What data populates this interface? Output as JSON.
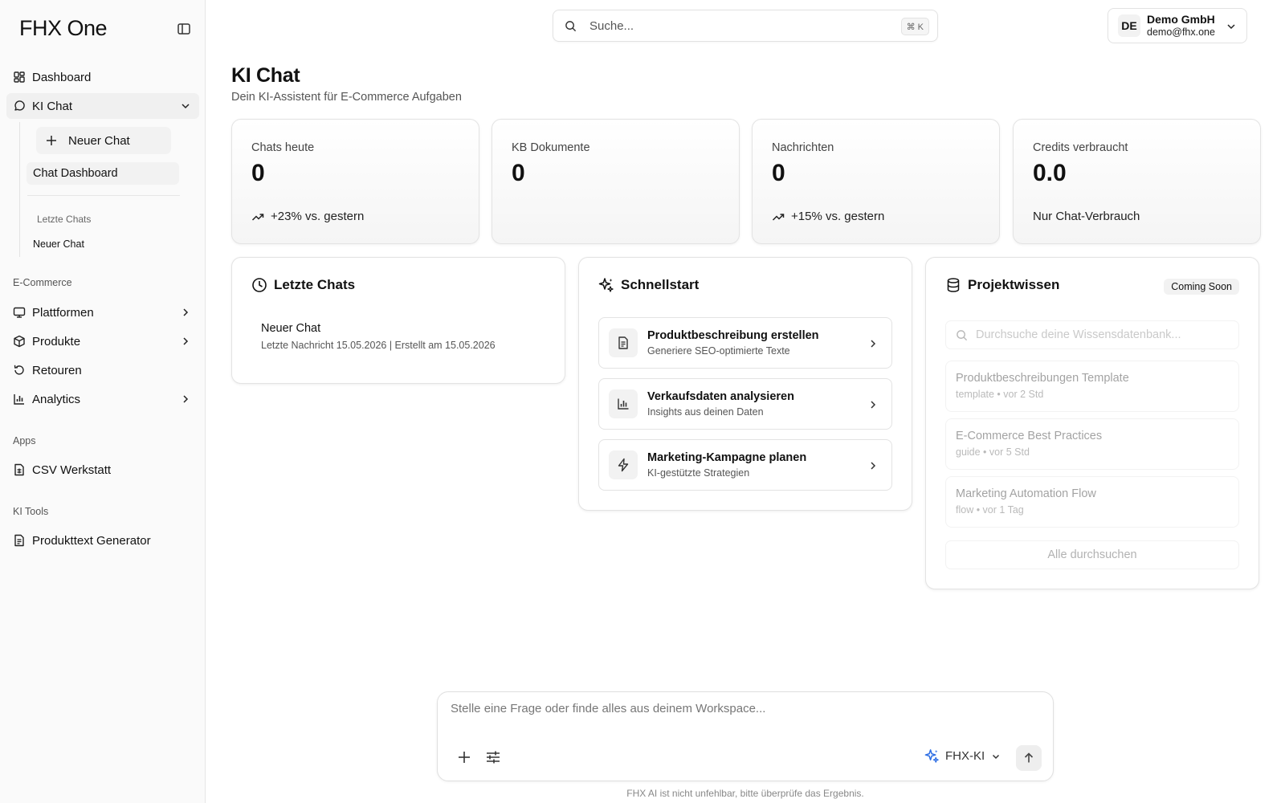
{
  "sidebar": {
    "brand": "FHX One",
    "nav_top": [
      {
        "label": "Dashboard"
      },
      {
        "label": "KI Chat"
      }
    ],
    "ki_chat": {
      "new_chat": "Neuer Chat",
      "chat_dashboard": "Chat Dashboard",
      "recent_caption": "Letzte Chats",
      "recent": [
        "Neuer Chat"
      ]
    },
    "ecommerce": {
      "label": "E-Commerce",
      "items": [
        {
          "label": "Plattformen"
        },
        {
          "label": "Produkte"
        },
        {
          "label": "Retouren"
        },
        {
          "label": "Analytics"
        }
      ]
    },
    "apps": {
      "label": "Apps",
      "items": [
        {
          "label": "CSV Werkstatt"
        }
      ]
    },
    "ki_tools": {
      "label": "KI Tools",
      "items": [
        {
          "label": "Produkttext Generator"
        }
      ]
    }
  },
  "topbar": {
    "search_placeholder": "Suche...",
    "shortcut": "⌘ K",
    "account": {
      "initials": "DE",
      "name": "Demo GmbH",
      "email": "demo@fhx.one"
    }
  },
  "header": {
    "title": "KI Chat",
    "subtitle": "Dein KI-Assistent für E-Commerce Aufgaben"
  },
  "stats": [
    {
      "label": "Chats heute",
      "value": "0",
      "footer": "+23% vs. gestern"
    },
    {
      "label": "KB Dokumente",
      "value": "0",
      "footer": ""
    },
    {
      "label": "Nachrichten",
      "value": "0",
      "footer": "+15% vs. gestern"
    },
    {
      "label": "Credits verbraucht",
      "value": "0.0",
      "footer": "Nur Chat-Verbrauch"
    }
  ],
  "recent_chats": {
    "title": "Letzte Chats",
    "items": [
      {
        "title": "Neuer Chat",
        "meta": "Letzte Nachricht 15.05.2026 | Erstellt am 15.05.2026"
      }
    ]
  },
  "quickstart": {
    "title": "Schnellstart",
    "items": [
      {
        "title": "Produktbeschreibung erstellen",
        "subtitle": "Generiere SEO-optimierte Texte",
        "icon": "document-icon"
      },
      {
        "title": "Verkaufsdaten analysieren",
        "subtitle": "Insights aus deinen Daten",
        "icon": "bar-chart-icon"
      },
      {
        "title": "Marketing-Kampagne planen",
        "subtitle": "KI-gestützte Strategien",
        "icon": "lightning-icon"
      }
    ]
  },
  "project_knowledge": {
    "title": "Projektwissen",
    "badge": "Coming Soon",
    "search_placeholder": "Durchsuche deine Wissensdatenbank...",
    "items": [
      {
        "title": "Produktbeschreibungen Template",
        "meta": "template • vor 2 Std"
      },
      {
        "title": "E-Commerce Best Practices",
        "meta": "guide • vor 5 Std"
      },
      {
        "title": "Marketing Automation Flow",
        "meta": "flow • vor 1 Tag"
      }
    ],
    "search_all": "Alle durchsuchen"
  },
  "composer": {
    "placeholder": "Stelle eine Frage oder finde alles aus deinem Workspace...",
    "model": "FHX-KI",
    "disclaimer": "FHX AI ist nicht unfehlbar, bitte überprüfe das Ergebnis."
  },
  "colors": {
    "accent": "#2f6fe4",
    "text": "#111111",
    "muted": "#555555",
    "border": "#e3e3e3"
  }
}
